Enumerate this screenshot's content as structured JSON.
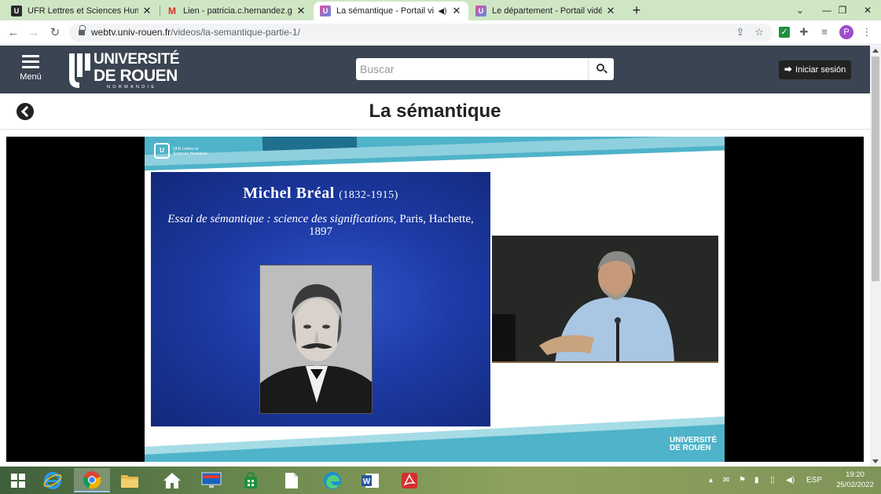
{
  "browser": {
    "tabs": [
      {
        "title": "UFR Lettres et Sciences Humaine",
        "favicon": "univ-logo-icon",
        "active": false
      },
      {
        "title": "Lien - patricia.c.hernandez.gr@g",
        "favicon": "gmail-icon",
        "active": false
      },
      {
        "title": "La sémantique - Portail vidéo",
        "favicon": "univ-logo-icon",
        "active": true,
        "muted_icon": "speaker-icon"
      },
      {
        "title": "Le département - Portail vidéo d",
        "favicon": "univ-logo-icon",
        "active": false
      }
    ],
    "url_host": "webtv.univ-rouen.fr",
    "url_path": "/videos/la-semantique-partie-1/",
    "profile_initial": "P"
  },
  "site": {
    "menu_label": "Menú",
    "logo_line1": "UNIVERSITÉ",
    "logo_line2": "DE ROUEN",
    "logo_line3": "NORMANDIE",
    "search_placeholder": "Buscar",
    "login_label": "Iniciar sesión"
  },
  "page": {
    "title": "La sémantique"
  },
  "video": {
    "slide_title": "Michel Bréal",
    "slide_dates": "(1832-1915)",
    "slide_book_italic": "Essai de sémantique : science des significations",
    "slide_book_rest": ", Paris, Hachette, 1897",
    "ufr_logo_text": "UFR Lettres et Sciences Humaines",
    "footer_logo_line1": "UNIVERSITÉ",
    "footer_logo_line2": "DE ROUEN"
  },
  "taskbar": {
    "language": "ESP",
    "time": "19:20",
    "date": "25/02/2022"
  },
  "colors": {
    "header_bg": "#3a4452",
    "tab_strip": "#cfe6c4",
    "slide_blue": "#1d3ba6",
    "band_cyan": "#4fb3c9"
  }
}
